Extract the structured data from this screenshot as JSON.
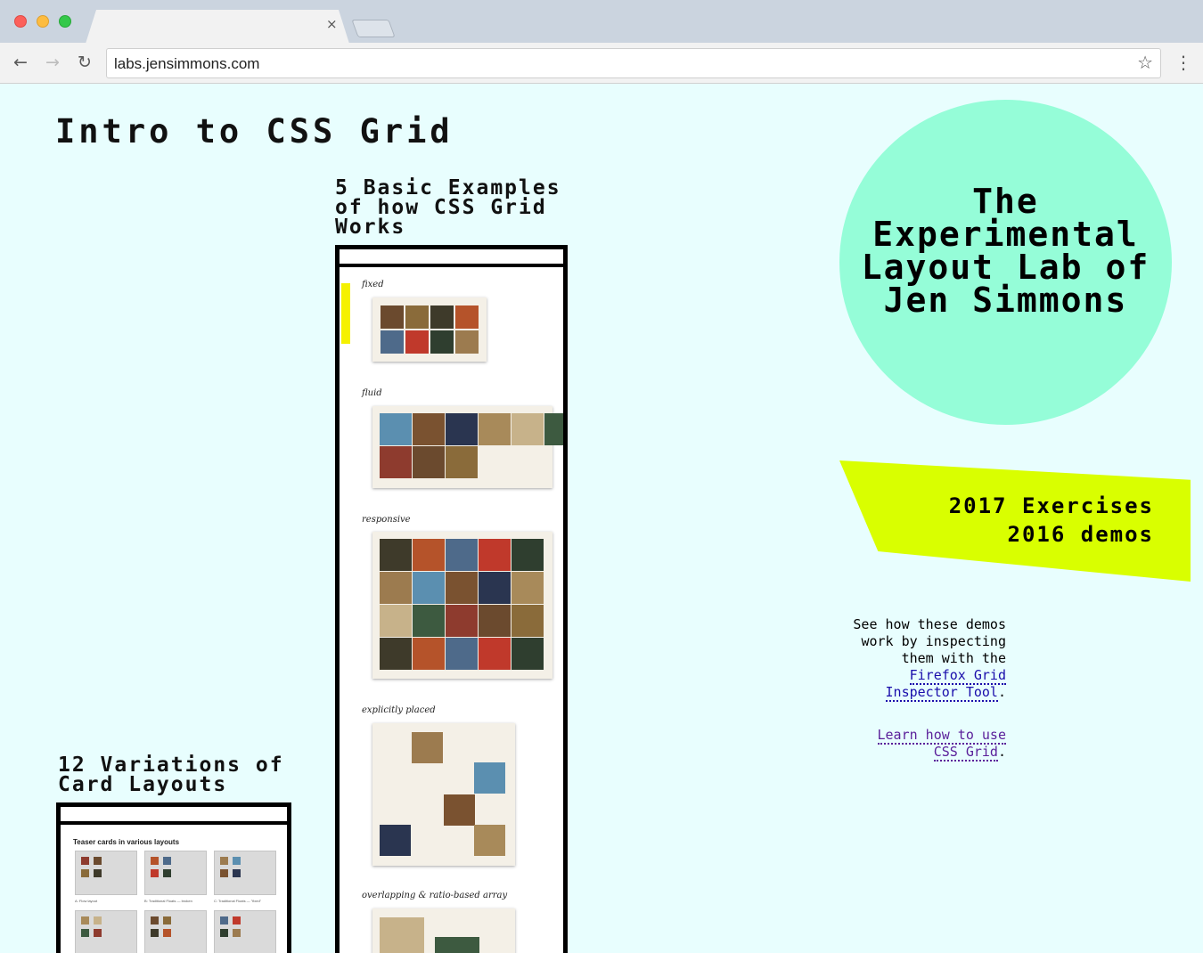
{
  "browser": {
    "url": "labs.jensimmons.com",
    "close_glyph": "×",
    "back_glyph": "←",
    "forward_glyph": "→",
    "reload_glyph": "↻",
    "star_glyph": "☆",
    "menu_glyph": "⋮"
  },
  "page": {
    "title": "Intro to CSS Grid",
    "basic_examples": {
      "heading": "5 Basic Examples of how CSS Grid Works",
      "demos": [
        {
          "label": "fixed"
        },
        {
          "label": "fluid"
        },
        {
          "label": "responsive"
        },
        {
          "label": "explicitly placed"
        },
        {
          "label": "overlapping & ratio-based array"
        }
      ]
    },
    "card_variations": {
      "heading": "12 Variations of Card Layouts",
      "preview_title": "Teaser cards in various layouts",
      "captions": [
        "A: Flow layout",
        "B: Traditional Floats — broken",
        "C: Traditional Floats — \"fixed\""
      ]
    },
    "lab": {
      "title": "The Experimental Layout Lab of Jen Simmons"
    },
    "banner": {
      "link1": "2017 Exercises",
      "link2": "2016 demos"
    },
    "inspect": {
      "prefix": "See how these demos work by inspecting them with the ",
      "link": "Firefox Grid Inspector Tool",
      "suffix": "."
    },
    "learn": {
      "link": "Learn how to use CSS Grid",
      "suffix": "."
    }
  },
  "colors": {
    "page_bg": "#e8fefe",
    "circle": "#95fdd8",
    "banner": "#d9ff00",
    "link": "#1a0dab",
    "visited_link": "#5a1f9a"
  }
}
